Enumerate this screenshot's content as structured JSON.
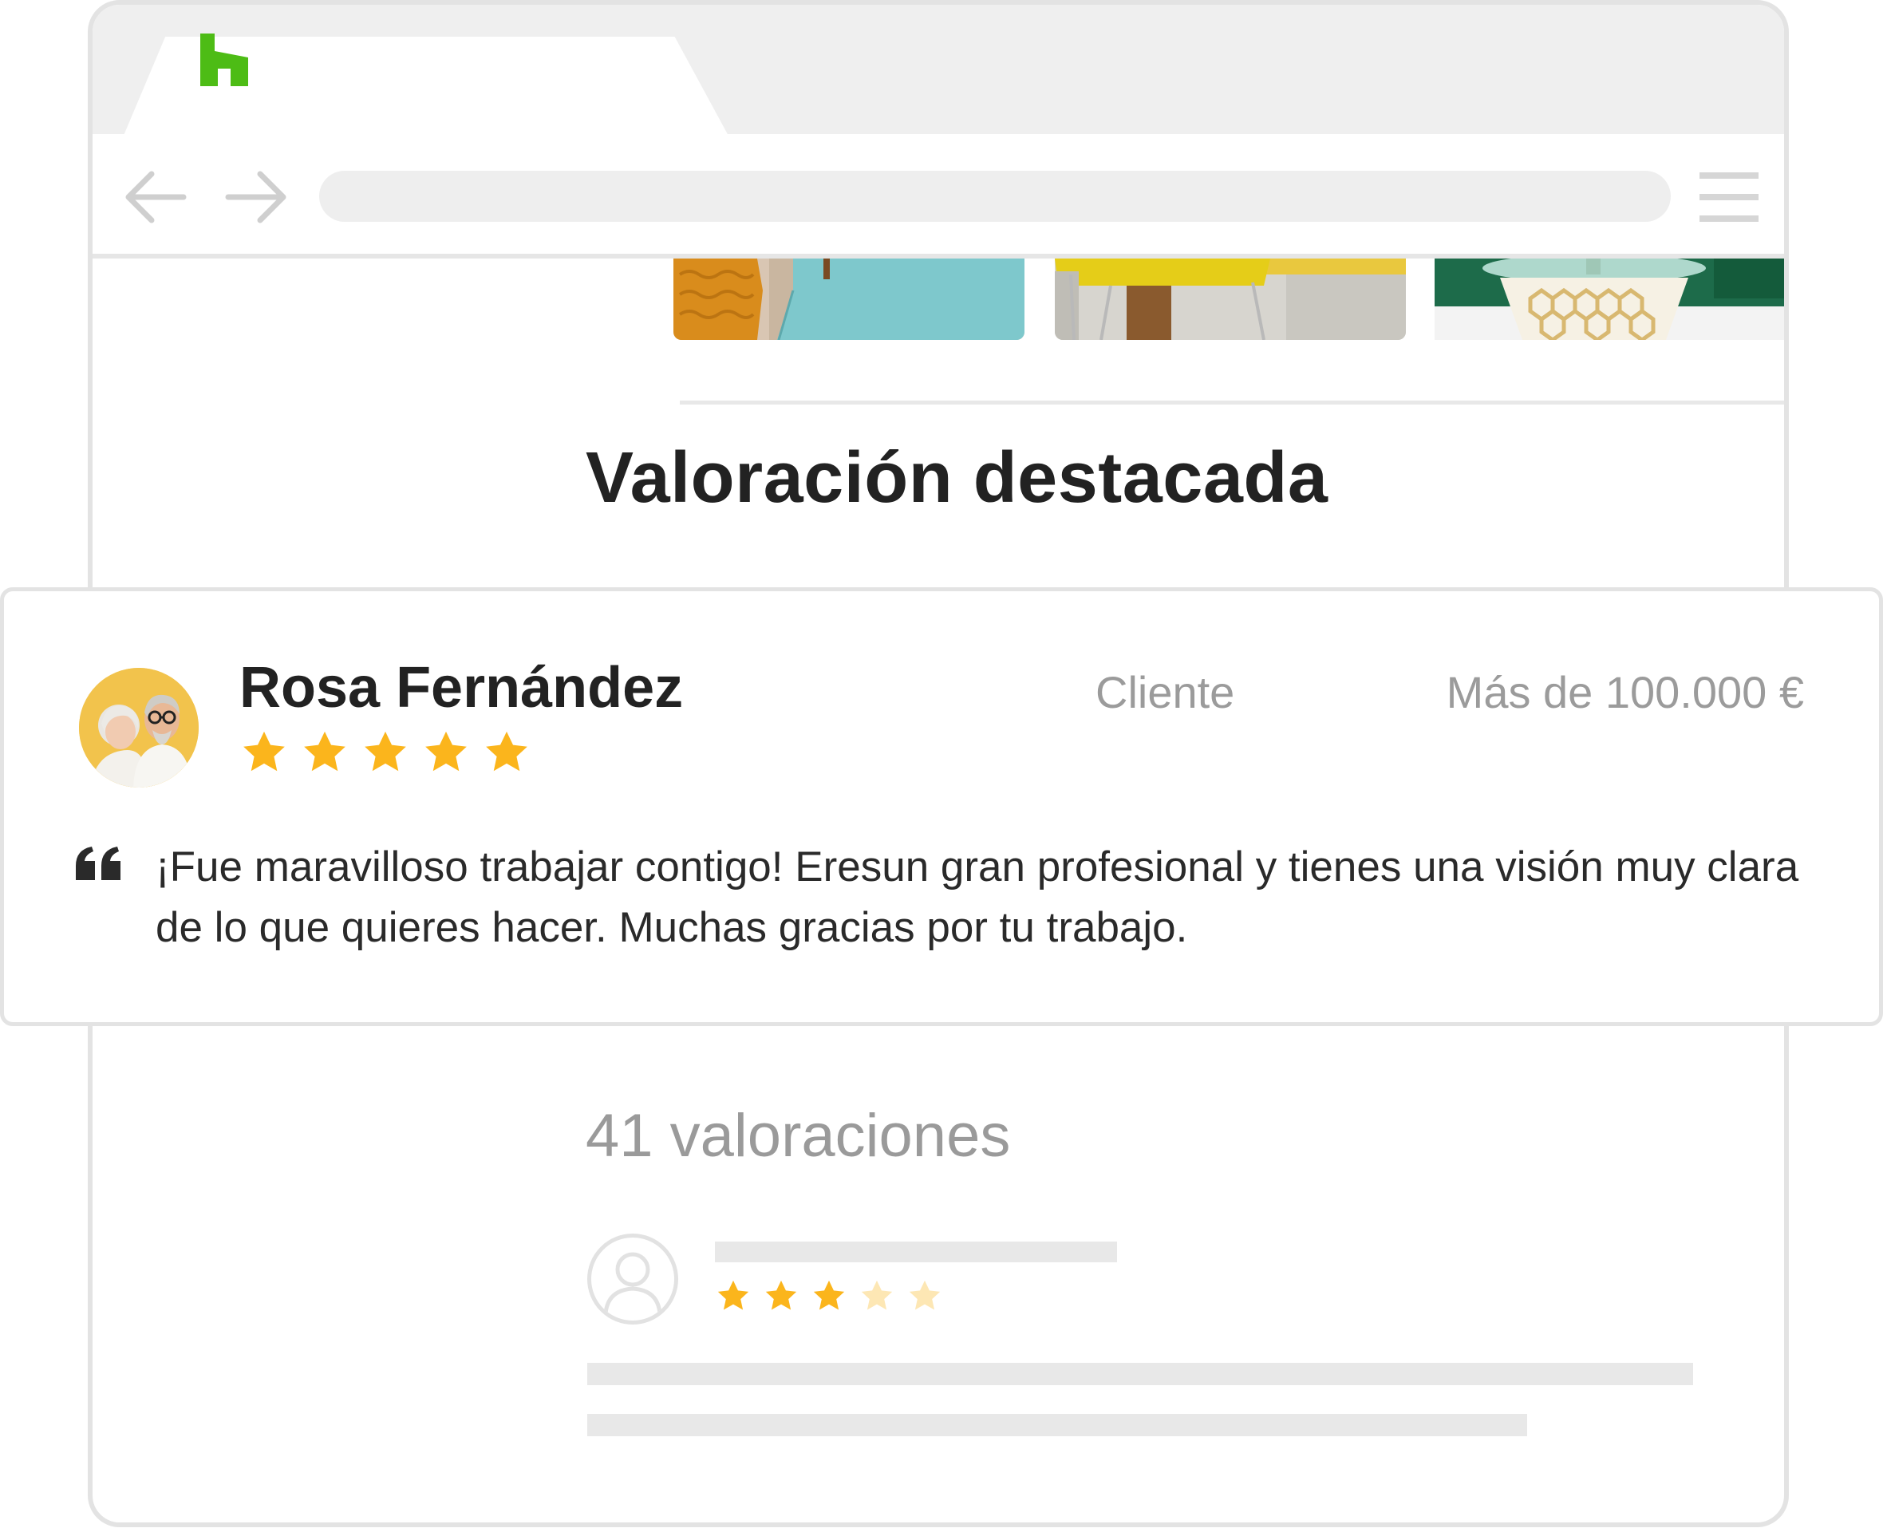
{
  "browser": {
    "brand_color": "#4dbc15",
    "icons": {
      "back": "arrow-left-icon",
      "forward": "arrow-right-icon",
      "menu": "hamburger-menu-icon",
      "logo": "houzz-logo-icon"
    }
  },
  "section": {
    "title": "Valoración destacada"
  },
  "featured_review": {
    "reviewer_name": "Rosa Fernández",
    "rating": 5,
    "rating_max": 5,
    "role": "Cliente",
    "budget": "Más de 100.000 €",
    "text": "¡Fue maravilloso trabajar contigo! Eresun gran profesional y tienes una visión muy clara de lo que quieres hacer. Muchas gracias por tu trabajo.",
    "star_color": "#fbb51c"
  },
  "reviews": {
    "count_label": "41 valoraciones",
    "placeholder_rating": 3,
    "placeholder_rating_max": 5,
    "empty_star_color": "#fde7b4"
  }
}
